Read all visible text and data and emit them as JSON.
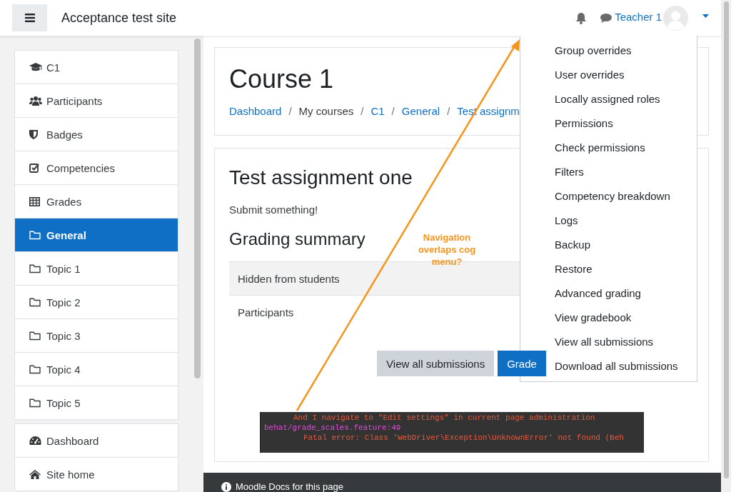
{
  "navbar": {
    "site_title": "Acceptance test site",
    "user_name": "Teacher 1"
  },
  "sidebar": {
    "sections": [
      [
        {
          "label": "C1",
          "kind": "cap",
          "selected": false
        },
        {
          "label": "Participants",
          "kind": "users",
          "selected": false
        },
        {
          "label": "Badges",
          "kind": "shield",
          "selected": false
        },
        {
          "label": "Competencies",
          "kind": "checkbox",
          "selected": false
        },
        {
          "label": "Grades",
          "kind": "table",
          "selected": false
        },
        {
          "label": "General",
          "kind": "folder",
          "selected": true
        },
        {
          "label": "Topic 1",
          "kind": "folder",
          "selected": false
        },
        {
          "label": "Topic 2",
          "kind": "folder",
          "selected": false
        },
        {
          "label": "Topic 3",
          "kind": "folder",
          "selected": false
        },
        {
          "label": "Topic 4",
          "kind": "folder",
          "selected": false
        },
        {
          "label": "Topic 5",
          "kind": "folder",
          "selected": false
        }
      ],
      [
        {
          "label": "Dashboard",
          "kind": "dashboard",
          "selected": false
        },
        {
          "label": "Site home",
          "kind": "home",
          "selected": false
        }
      ]
    ]
  },
  "page_header": {
    "title": "Course 1",
    "separator": "/",
    "breadcrumb": [
      {
        "label": "Dashboard",
        "kind": "link"
      },
      {
        "label": "My courses",
        "kind": "text"
      },
      {
        "label": "C1",
        "kind": "link"
      },
      {
        "label": "General",
        "kind": "link"
      },
      {
        "label": "Test assignm",
        "kind": "link"
      }
    ]
  },
  "assignment": {
    "title": "Test assignment one",
    "description": "Submit something!",
    "grading_summary": {
      "heading": "Grading summary",
      "rows": [
        {
          "label": "Hidden from students"
        },
        {
          "label": "Participants"
        }
      ]
    },
    "buttons": [
      {
        "label": "View all submissions",
        "kind": "secondary"
      },
      {
        "label": "Grade",
        "kind": "primary"
      }
    ]
  },
  "console": {
    "lines": [
      {
        "text": "And I navigate to \"Edit settings\" in current page administration",
        "kind": "step"
      },
      {
        "text": "behat/grade_scales.feature:49",
        "kind": "location"
      },
      {
        "text": "Fatal error: Class 'WebDriver\\Exception\\UnknownError' not found (Beh",
        "kind": "error"
      }
    ]
  },
  "annotation": {
    "text": "Navigation overlaps cog menu?"
  },
  "dropdown_menu": {
    "items": [
      "Group overrides",
      "User overrides",
      "Locally assigned roles",
      "Permissions",
      "Check permissions",
      "Filters",
      "Competency breakdown",
      "Logs",
      "Backup",
      "Restore",
      "Advanced grading",
      "View gradebook",
      "View all submissions",
      "Download all submissions"
    ]
  },
  "footer": {
    "text": "Moodle Docs for this page"
  }
}
